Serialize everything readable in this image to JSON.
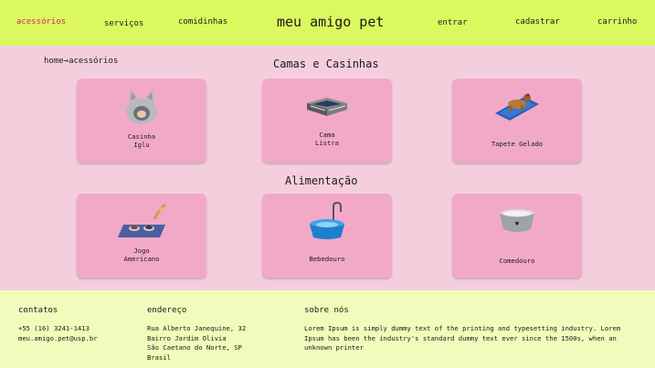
{
  "header": {
    "nav_left": [
      "acessórios",
      "serviços",
      "comidinhas"
    ],
    "logo": "meu amigo pet",
    "nav_right": [
      "entrar",
      "cadastrar",
      "carrinho"
    ],
    "accent_color": "#e0235f",
    "bg_color": "#dbf95e"
  },
  "breadcrumb": "home→acessórios",
  "sections": [
    {
      "title": "Camas e Casinhas",
      "items": [
        {
          "label": "Casinha\nIglu",
          "icon": "cat-igloo-bed-icon"
        },
        {
          "label": "Cama\nListra",
          "icon": "striped-bed-icon"
        },
        {
          "label": "Tapete Gelado",
          "icon": "cooling-mat-icon"
        }
      ]
    },
    {
      "title": "Alimentação",
      "items": [
        {
          "label": "Jogo\nAmericano",
          "icon": "placemat-icon"
        },
        {
          "label": "Bebedouro",
          "icon": "water-fountain-icon"
        },
        {
          "label": "Comedouro",
          "icon": "food-bowl-icon"
        }
      ]
    }
  ],
  "footer": {
    "contatos": {
      "title": "contatos",
      "lines": [
        "+55 (16) 3241-1413",
        "meu.amigo.pet@usp.br"
      ]
    },
    "endereco": {
      "title": "endereço",
      "lines": [
        "Rua Alberto Janequine, 32",
        "Bairro Jardim Olivia",
        "São Caetano do Norte, SP",
        "Brasil"
      ]
    },
    "sobre": {
      "title": "sobre nós",
      "text": "Lorem Ipsum is simply dummy text of the printing and typesetting industry. Lorem Ipsum has been the industry's standard dummy text ever since the 1500s, when an unknown printer"
    }
  }
}
